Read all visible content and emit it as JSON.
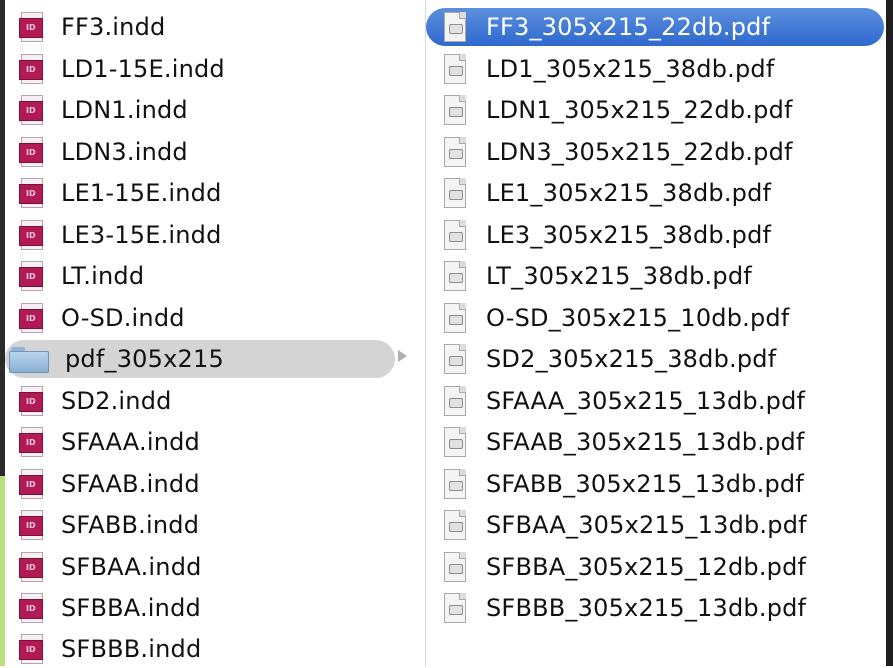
{
  "left_column": {
    "items": [
      {
        "label": "FF3.indd",
        "icon": "indesign-file-icon"
      },
      {
        "label": "LD1-15E.indd",
        "icon": "indesign-file-icon"
      },
      {
        "label": "LDN1.indd",
        "icon": "indesign-file-icon"
      },
      {
        "label": "LDN3.indd",
        "icon": "indesign-file-icon"
      },
      {
        "label": "LE1-15E.indd",
        "icon": "indesign-file-icon"
      },
      {
        "label": "LE3-15E.indd",
        "icon": "indesign-file-icon"
      },
      {
        "label": "LT.indd",
        "icon": "indesign-file-icon"
      },
      {
        "label": "O-SD.indd",
        "icon": "indesign-file-icon"
      },
      {
        "label": "pdf_305x215",
        "icon": "folder-icon",
        "selected": true
      },
      {
        "label": "SD2.indd",
        "icon": "indesign-file-icon"
      },
      {
        "label": "SFAAA.indd",
        "icon": "indesign-file-icon"
      },
      {
        "label": "SFAAB.indd",
        "icon": "indesign-file-icon"
      },
      {
        "label": "SFABB.indd",
        "icon": "indesign-file-icon"
      },
      {
        "label": "SFBAA.indd",
        "icon": "indesign-file-icon"
      },
      {
        "label": "SFBBA.indd",
        "icon": "indesign-file-icon"
      },
      {
        "label": "SFBBB.indd",
        "icon": "indesign-file-icon"
      }
    ]
  },
  "right_column": {
    "items": [
      {
        "label": "FF3_305x215_22db.pdf",
        "icon": "pdf-file-icon",
        "selected": true
      },
      {
        "label": "LD1_305x215_38db.pdf",
        "icon": "pdf-file-icon"
      },
      {
        "label": "LDN1_305x215_22db.pdf",
        "icon": "pdf-file-icon"
      },
      {
        "label": "LDN3_305x215_22db.pdf",
        "icon": "pdf-file-icon"
      },
      {
        "label": "LE1_305x215_38db.pdf",
        "icon": "pdf-file-icon"
      },
      {
        "label": "LE3_305x215_38db.pdf",
        "icon": "pdf-file-icon"
      },
      {
        "label": "LT_305x215_38db.pdf",
        "icon": "pdf-file-icon"
      },
      {
        "label": "O-SD_305x215_10db.pdf",
        "icon": "pdf-file-icon"
      },
      {
        "label": "SD2_305x215_38db.pdf",
        "icon": "pdf-file-icon"
      },
      {
        "label": "SFAAA_305x215_13db.pdf",
        "icon": "pdf-file-icon"
      },
      {
        "label": "SFAAB_305x215_13db.pdf",
        "icon": "pdf-file-icon"
      },
      {
        "label": "SFABB_305x215_13db.pdf",
        "icon": "pdf-file-icon"
      },
      {
        "label": "SFBAA_305x215_13db.pdf",
        "icon": "pdf-file-icon"
      },
      {
        "label": "SFBBA_305x215_12db.pdf",
        "icon": "pdf-file-icon"
      },
      {
        "label": "SFBBB_305x215_13db.pdf",
        "icon": "pdf-file-icon"
      }
    ]
  },
  "colors": {
    "selection_blue": "#3a74d6",
    "selection_gray": "#d4d4d4",
    "indesign_badge": "#b21a55",
    "folder_blue": "#9fc2e2"
  }
}
